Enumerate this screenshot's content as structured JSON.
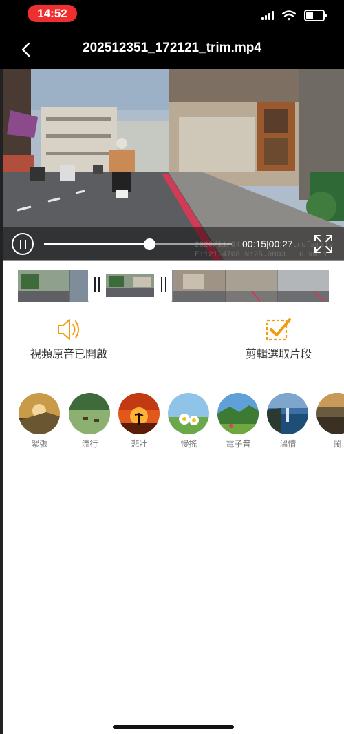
{
  "status_bar": {
    "time": "14:52",
    "accent_color": "#ef2f2f"
  },
  "header": {
    "title": "202512351_172121_trim.mp4"
  },
  "player": {
    "progress_fraction": 0.56,
    "time_readout": "00:15|00:27",
    "overlay_date": "2020/11/04",
    "overlay_brand": "trofamily",
    "overlay_coords": "E:121.4708 N:25.0003",
    "overlay_speed": "0 km/h"
  },
  "actions": {
    "sound_label": "視頻原音已開啟",
    "trim_label": "剪輯選取片段",
    "accent_color": "#f39c12"
  },
  "music": {
    "items": [
      {
        "label": "緊張"
      },
      {
        "label": "流行"
      },
      {
        "label": "悲壯"
      },
      {
        "label": "慢搖"
      },
      {
        "label": "電子音"
      },
      {
        "label": "溫情"
      },
      {
        "label": "鬧"
      }
    ]
  }
}
